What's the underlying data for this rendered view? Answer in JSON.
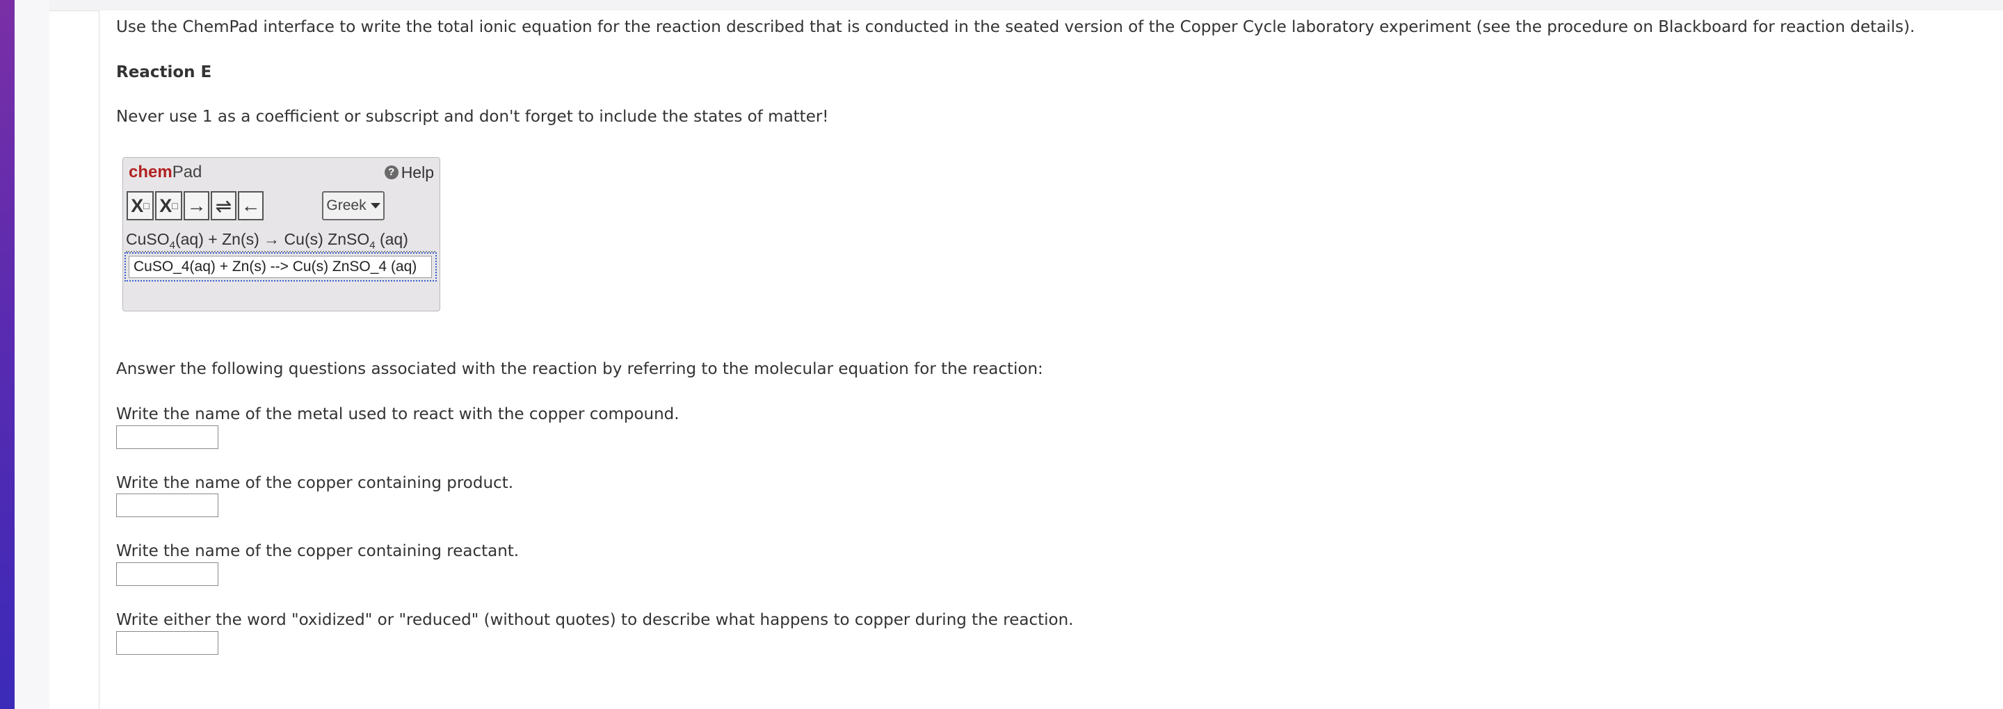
{
  "instructions": {
    "intro": "Use the ChemPad interface to write the total ionic equation for the reaction described that is conducted in the seated version of the Copper Cycle laboratory experiment (see the procedure on Blackboard for reaction details).",
    "reaction_heading": "Reaction E",
    "note": "Never use 1 as a coefficient or subscript and don't forget to include the states of matter!"
  },
  "chempad": {
    "brand_chem": "chem",
    "brand_pad": "Pad",
    "help_label": "Help",
    "greek_label": "Greek",
    "preview_parts": [
      "CuSO",
      "4",
      "(aq) + Zn(s)  →  Cu(s) ZnSO",
      "4",
      " (aq)"
    ],
    "input_value": "CuSO_4(aq) + Zn(s) --> Cu(s) ZnSO_4 (aq)"
  },
  "questions": {
    "intro": "Answer the following questions associated with the reaction by referring to the molecular equation for the reaction:",
    "items": [
      {
        "label": "Write the name of the metal used to react with the copper compound.",
        "value": ""
      },
      {
        "label": "Write the name of the copper containing product.",
        "value": ""
      },
      {
        "label": "Write the name of the copper containing reactant.",
        "value": ""
      },
      {
        "label": "Write either the word \"oxidized\" or \"reduced\" (without quotes) to describe what happens to copper during the reaction.",
        "value": ""
      }
    ]
  },
  "colors": {
    "brand_accent": "#b22222",
    "sidebar_gradient_top": "#7a2fa6",
    "sidebar_gradient_bottom": "#3b2ab8"
  }
}
